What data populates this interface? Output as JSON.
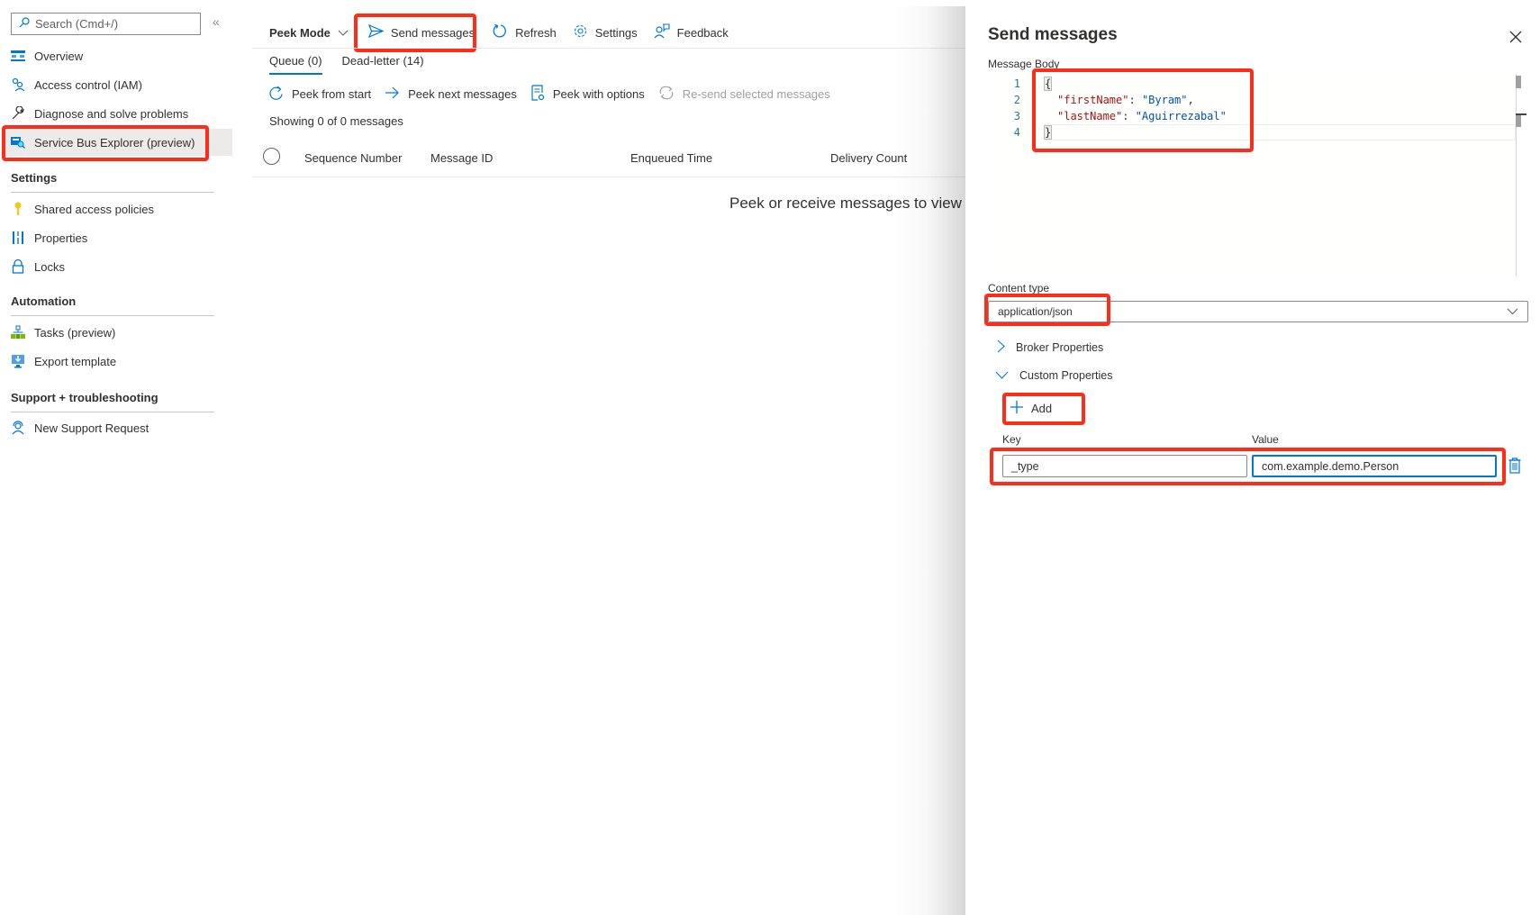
{
  "sidebar": {
    "search_placeholder": "Search (Cmd+/)",
    "collapse_icon": "«",
    "items": [
      {
        "label": "Overview",
        "icon": "overview-icon"
      },
      {
        "label": "Access control (IAM)",
        "icon": "people-icon"
      },
      {
        "label": "Diagnose and solve problems",
        "icon": "wrench-icon"
      },
      {
        "label": "Service Bus Explorer (preview)",
        "icon": "explorer-icon",
        "active": true
      }
    ],
    "sections": [
      {
        "title": "Settings",
        "items": [
          {
            "label": "Shared access policies",
            "icon": "key-icon"
          },
          {
            "label": "Properties",
            "icon": "properties-icon"
          },
          {
            "label": "Locks",
            "icon": "lock-icon"
          }
        ]
      },
      {
        "title": "Automation",
        "items": [
          {
            "label": "Tasks (preview)",
            "icon": "tasks-icon"
          },
          {
            "label": "Export template",
            "icon": "export-icon"
          }
        ]
      },
      {
        "title": "Support + troubleshooting",
        "items": [
          {
            "label": "New Support Request",
            "icon": "support-icon"
          }
        ]
      }
    ]
  },
  "toolbar": {
    "peek_mode": "Peek Mode",
    "send_messages": "Send messages",
    "refresh": "Refresh",
    "settings": "Settings",
    "feedback": "Feedback"
  },
  "tabs": [
    {
      "label": "Queue (0)",
      "active": true
    },
    {
      "label": "Dead-letter (14)",
      "active": false
    }
  ],
  "actions": {
    "peek_from_start": "Peek from start",
    "peek_next": "Peek next messages",
    "peek_with_options": "Peek with options",
    "resend": "Re-send selected messages"
  },
  "status": "Showing 0 of 0 messages",
  "table": {
    "columns": [
      "Sequence Number",
      "Message ID",
      "Enqueued Time",
      "Delivery Count"
    ],
    "empty_message": "Peek or receive messages to view"
  },
  "panel": {
    "title": "Send messages",
    "message_body_label": "Message Body",
    "code_lines": [
      {
        "num": "1",
        "text": "{"
      },
      {
        "num": "2",
        "key": "\"firstName\"",
        "value": "\"Byram\"",
        "trail": ","
      },
      {
        "num": "3",
        "key": "\"lastName\"",
        "value": "\"Aguirrezabal\"",
        "trail": ""
      },
      {
        "num": "4",
        "text": "}"
      }
    ],
    "content_type_label": "Content type",
    "content_type_value": "application/json",
    "broker_properties": "Broker Properties",
    "custom_properties": "Custom Properties",
    "add_label": "Add",
    "key_label": "Key",
    "value_label": "Value",
    "custom_property": {
      "key": "_type",
      "value": "com.example.demo.Person"
    }
  },
  "colors": {
    "accent": "#0078d4",
    "highlight": "#fe2d1a",
    "json_key": "#a31515",
    "json_string": "#0451a5"
  }
}
